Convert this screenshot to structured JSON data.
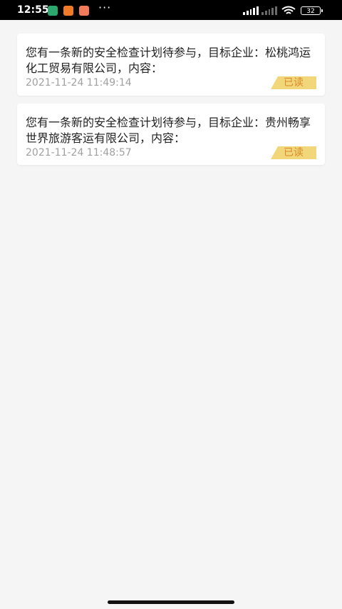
{
  "status_bar": {
    "time": "12:55",
    "icons": [
      "security-app-icon",
      "mi-app-icon",
      "gift-app-icon"
    ],
    "more": "···",
    "battery": "32"
  },
  "notifications": [
    {
      "title": "您有一条新的安全检查计划待参与，目标企业：松桃鸿运化工贸易有限公司，内容：",
      "time": "2021-11-24 11:49:14",
      "status": "已读"
    },
    {
      "title": "您有一条新的安全检查计划待参与，目标企业：贵州畅享世界旅游客运有限公司，内容：",
      "time": "2021-11-24 11:48:57",
      "status": "已读"
    }
  ],
  "colors": {
    "background": "#f5f5f5",
    "badge_background": "#f2d77a",
    "badge_text": "#d88a2a",
    "time_text": "#a0a0a0",
    "title_text": "#222222"
  }
}
